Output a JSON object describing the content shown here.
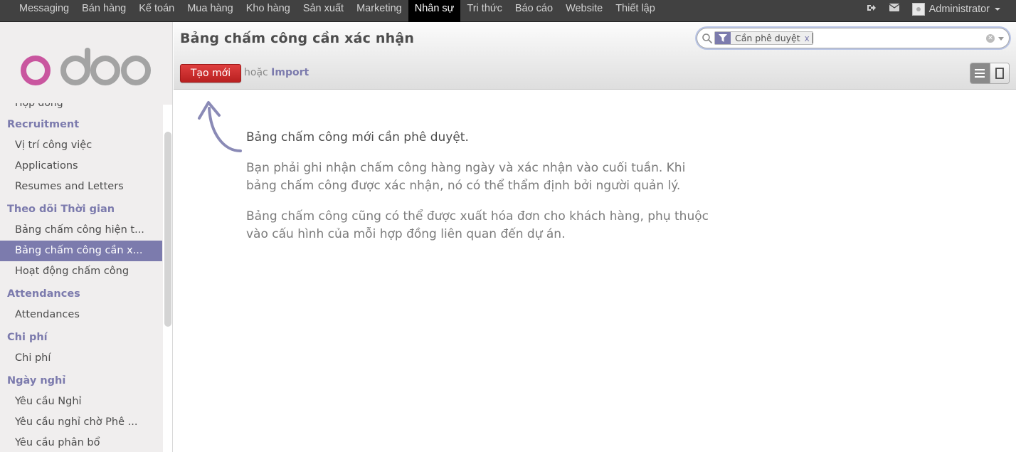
{
  "topnav": {
    "items": [
      "Messaging",
      "Bán hàng",
      "Kế toán",
      "Mua hàng",
      "Kho hàng",
      "Sản xuất",
      "Marketing",
      "Nhân sự",
      "Tri thức",
      "Báo cáo",
      "Website",
      "Thiết lập"
    ],
    "active": "Nhân sự",
    "user": "Administrator"
  },
  "sidebar": {
    "cut_item": "Hợp đồng",
    "sections": [
      {
        "title": "Recruitment",
        "items": [
          "Vị trí công việc",
          "Applications",
          "Resumes and Letters"
        ]
      },
      {
        "title": "Theo dõi Thời gian",
        "items": [
          "Bảng chấm công hiện t...",
          "Bảng chấm công cần x...",
          "Hoạt động chấm công"
        ]
      },
      {
        "title": "Attendances",
        "items": [
          "Attendances"
        ]
      },
      {
        "title": "Chi phí",
        "items": [
          "Chi phí"
        ]
      },
      {
        "title": "Ngày nghỉ",
        "items": [
          "Yêu cầu Nghỉ",
          "Yêu cầu nghỉ chờ Phê ...",
          "Yêu cầu phân bổ"
        ]
      }
    ],
    "active_item": "Bảng chấm công cần x..."
  },
  "control_panel": {
    "title": "Bảng chấm công cần xác nhận",
    "create_label": "Tạo mới",
    "or_label": "hoặc",
    "import_label": "Import"
  },
  "search": {
    "facet_label": "Cần phê duyệt",
    "facet_close": "x",
    "query": ""
  },
  "help": {
    "title": "Bảng chấm công mới cần phê duyệt.",
    "p1": "Bạn phải ghi nhận chấm công hàng ngày và xác nhận vào cuối tuần. Khi bảng chấm công được xác nhận, nó có thể thẩm định bởi người quản lý.",
    "p2": "Bảng chấm công cũng có thể được xuất hóa đơn cho khách hàng, phụ thuộc vào cấu hình của mỗi hợp đồng liên quan đến dự án."
  },
  "colors": {
    "accent": "#7c7bad",
    "primary_button": "#c72c2c",
    "topbar": "#414141"
  },
  "icons": [
    "logout-icon",
    "mail-icon",
    "search-icon",
    "filter-icon",
    "clear-icon",
    "list-view-icon",
    "form-view-icon"
  ]
}
